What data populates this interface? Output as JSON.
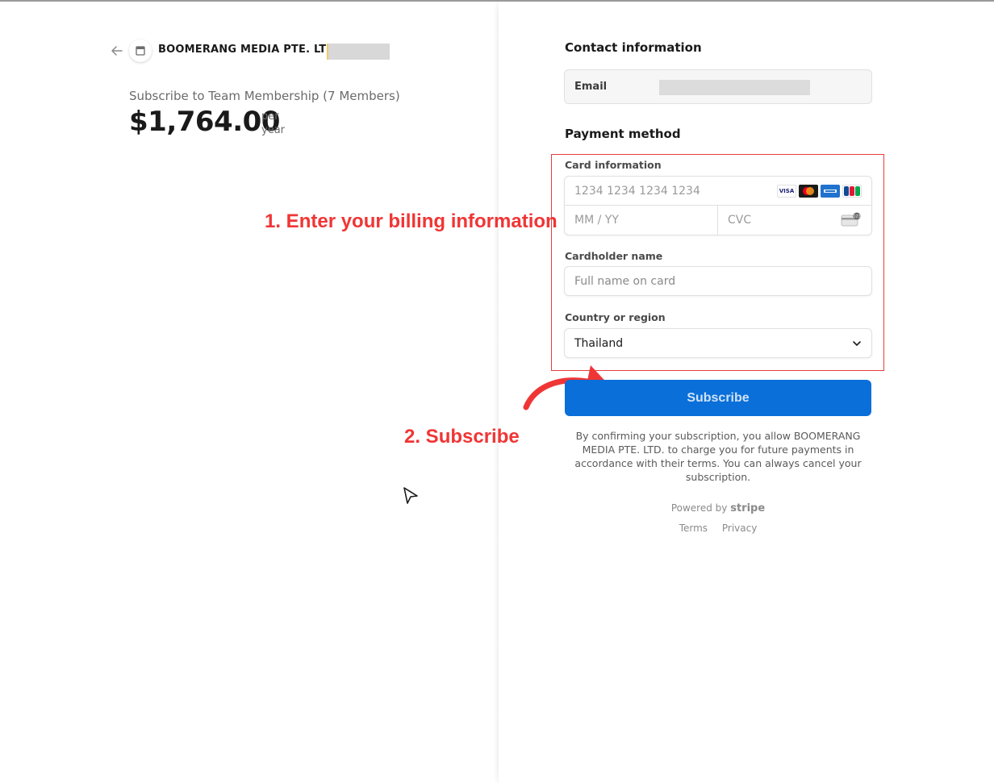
{
  "merchant": {
    "name": "BOOMERANG MEDIA PTE. LTD."
  },
  "summary": {
    "product_title": "Subscribe to Team Membership (7 Members)",
    "price": "$1,764.00",
    "unit_line1": "per",
    "unit_line2": "year"
  },
  "contact": {
    "title": "Contact information",
    "email_label": "Email"
  },
  "payment": {
    "title": "Payment method",
    "card_label": "Card information",
    "card_number_placeholder": "1234 1234 1234 1234",
    "expiry_placeholder": "MM / YY",
    "cvc_placeholder": "CVC",
    "brands": [
      "VISA",
      "mastercard",
      "AMEX",
      "JCB"
    ],
    "cardholder_label": "Cardholder name",
    "cardholder_placeholder": "Full name on card",
    "country_label": "Country or region",
    "country_value": "Thailand"
  },
  "actions": {
    "subscribe_label": "Subscribe"
  },
  "legal": {
    "text": "By confirming your subscription, you allow BOOMERANG MEDIA PTE. LTD. to charge you for future payments in accordance with their terms. You can always cancel your subscription."
  },
  "footer": {
    "powered_by": "Powered by",
    "brand": "stripe",
    "terms": "Terms",
    "privacy": "Privacy"
  },
  "annotations": {
    "step1": "1. Enter your billing information",
    "step2": "2. Subscribe",
    "color": "#f03535"
  },
  "colors": {
    "accent": "#0a6fd8",
    "annotation_red": "#f03535"
  }
}
